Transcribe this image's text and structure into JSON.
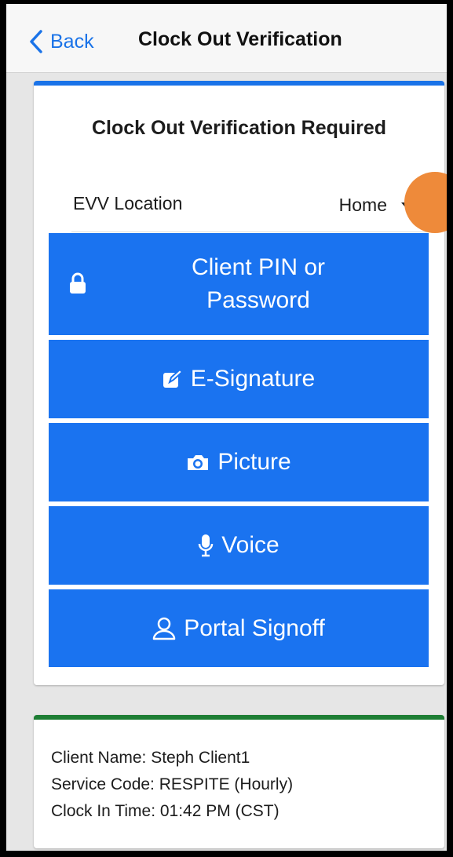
{
  "navbar": {
    "back_label": "Back",
    "title": "Clock Out Verification"
  },
  "main_card": {
    "title": "Clock Out Verification Required",
    "evv": {
      "label": "EVV Location",
      "value": "Home"
    },
    "buttons": {
      "pin": "Client PIN or Password",
      "esignature": "E-Signature",
      "picture": "Picture",
      "voice": "Voice",
      "portal": "Portal Signoff"
    }
  },
  "info_card": {
    "client_name": "Client Name: Steph Client1",
    "service_code": "Service Code: RESPITE (Hourly)",
    "clock_in_time": "Clock In Time: 01:42 PM (CST)"
  },
  "colors": {
    "accent_blue": "#1a73f0",
    "link_blue": "#1a73e8",
    "success_green": "#1e7e34",
    "fab_orange": "#ee8a3a"
  },
  "icons": [
    "chevron-left-icon",
    "lock-icon",
    "edit-icon",
    "camera-icon",
    "microphone-icon",
    "user-icon"
  ]
}
